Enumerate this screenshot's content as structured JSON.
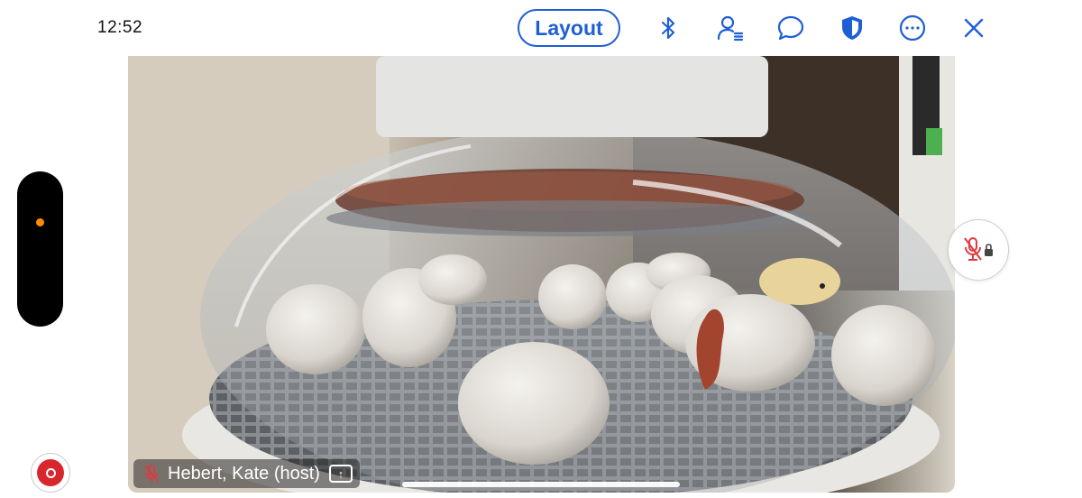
{
  "status_bar": {
    "time": "12:52"
  },
  "toolbar": {
    "layout_label": "Layout",
    "icons": [
      "bluetooth-icon",
      "participants-icon",
      "chat-icon",
      "security-shield-icon",
      "more-icon",
      "close-icon"
    ],
    "accent_color": "#1f5fd6"
  },
  "video": {
    "participant_name": "Hebert, Kate (host)",
    "mic_status": "muted",
    "share_icon": "share-screen-icon"
  },
  "controls": {
    "record_icon": "record-icon",
    "mute_lock_icon": "mic-muted-locked-icon",
    "record_color": "#d7262e",
    "indicator_color": "#ff8c00"
  }
}
